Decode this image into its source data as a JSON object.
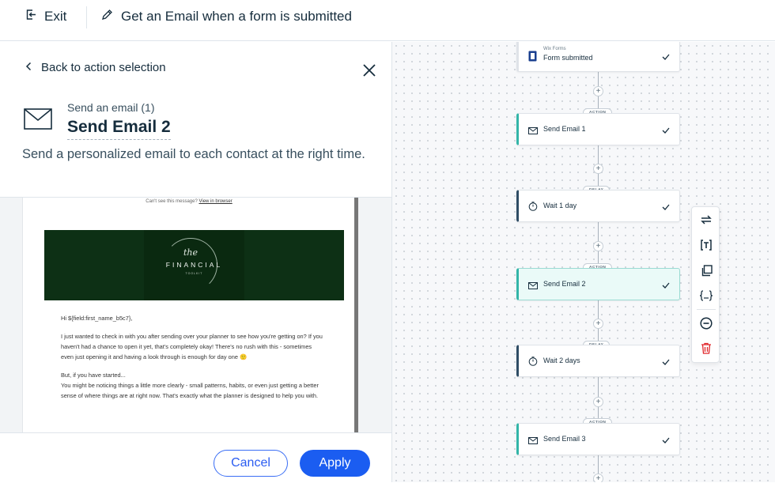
{
  "topbar": {
    "exit_label": "Exit",
    "flow_title": "Get an Email when a form is submitted"
  },
  "panel": {
    "back_label": "Back to action selection",
    "subtitle": "Send an email (1)",
    "title": "Send Email 2",
    "description": "Send a personalized email to each contact at the right time."
  },
  "email_preview": {
    "cant_see": "Can't see this message?",
    "view_in_browser": "View in browser",
    "banner_script": "the",
    "banner_title": "FINANCIAL",
    "banner_sub": "TOOLKIT",
    "greeting": "Hi ${field:first_name_b5c7},",
    "para1": "I just wanted to check in with you after sending over your planner to see how you're getting on? If you haven't had a chance to open it yet, that's completely okay! There's no rush with this - sometimes even just opening it and having a look through is enough for day one 🙂",
    "para2a": "But, if you have started...",
    "para2b": "You might be noticing things a little more clearly - small patterns, habits, or even just getting a better sense of where things are at right now. That's exactly what the planner is designed to help you with."
  },
  "footer": {
    "cancel_label": "Cancel",
    "apply_label": "Apply"
  },
  "flow": {
    "trigger": {
      "app": "Wix Forms",
      "label": "Form submitted"
    },
    "tag_action": "ACTION",
    "tag_delay": "DELAY",
    "plus": "+",
    "nodes": [
      {
        "label": "Send Email 1"
      },
      {
        "label": "Wait 1 day"
      },
      {
        "label": "Send Email 2"
      },
      {
        "label": "Wait 2 days"
      },
      {
        "label": "Send Email 3"
      }
    ]
  },
  "toolbar_icons": [
    "swap-icon",
    "text-bracket-icon",
    "duplicate-icon",
    "variable-braces-icon",
    "remove-circle-icon",
    "delete-icon"
  ],
  "colors": {
    "primary": "#1b5df1",
    "action_accent": "#33b5a8",
    "delay_accent": "#2f4d65",
    "delete": "#e0262a",
    "banner": "#0d3015"
  }
}
